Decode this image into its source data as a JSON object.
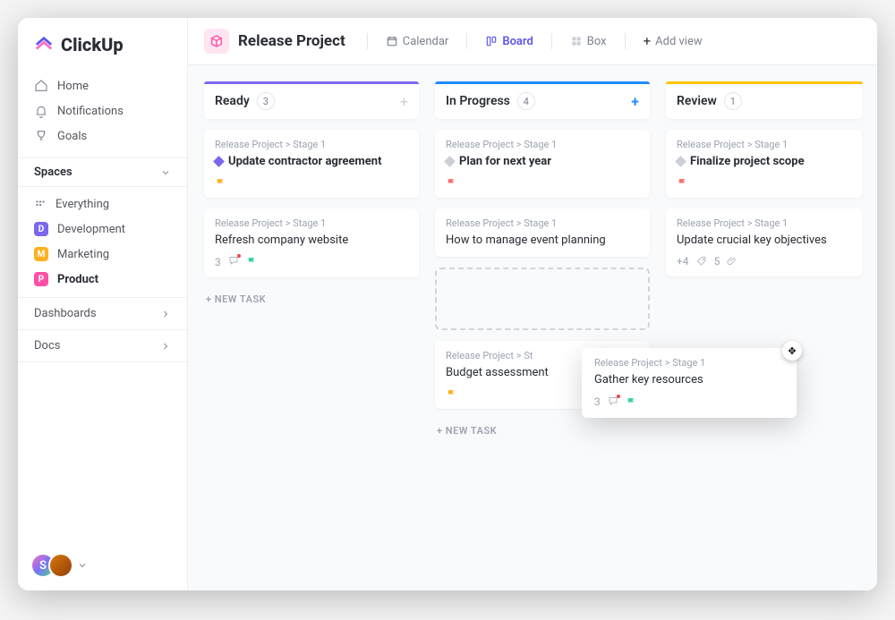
{
  "brand": "ClickUp",
  "nav": {
    "home": "Home",
    "notifications": "Notifications",
    "goals": "Goals"
  },
  "spaces": {
    "header": "Spaces",
    "everything": "Everything",
    "items": [
      {
        "label": "Development",
        "letter": "D",
        "color": "#7b68ee"
      },
      {
        "label": "Marketing",
        "letter": "M",
        "color": "#ffb020"
      },
      {
        "label": "Product",
        "letter": "P",
        "color": "#ff4fa7",
        "active": true
      }
    ]
  },
  "sections": {
    "dashboards": "Dashboards",
    "docs": "Docs"
  },
  "user": {
    "initial": "S"
  },
  "header": {
    "project_title": "Release Project",
    "views": {
      "calendar": "Calendar",
      "board": "Board",
      "box": "Box",
      "add": "Add view"
    }
  },
  "board": {
    "new_task_label": "+ NEW TASK",
    "columns": [
      {
        "name": "Ready",
        "count": "3",
        "bar_color": "#7b68ee",
        "add_color": "#cbd0d8",
        "cards": [
          {
            "crumb": "Release Project > Stage 1",
            "title": "Update contractor agreement",
            "bold": true,
            "diamond": "#7b68ee",
            "flag": "#ffb020"
          },
          {
            "crumb": "Release Project > Stage 1",
            "title": "Refresh company website",
            "comments": "3",
            "flag": "#34d399"
          }
        ]
      },
      {
        "name": "In Progress",
        "count": "4",
        "bar_color": "#1f8bff",
        "add_color": "#1f8bff",
        "cards": [
          {
            "crumb": "Release Project > Stage 1",
            "title": "Plan for next year",
            "bold": true,
            "diamond": "#cbd0d8",
            "flag": "#f97066"
          },
          {
            "crumb": "Release Project > Stage 1",
            "title": "How to manage event planning"
          },
          {
            "placeholder": true
          },
          {
            "crumb": "Release Project > St",
            "title": "Budget assessment",
            "flag": "#ffb020"
          }
        ]
      },
      {
        "name": "Review",
        "count": "1",
        "bar_color": "#ffc300",
        "add_color": "#cbd0d8",
        "cards": [
          {
            "crumb": "Release Project > Stage 1",
            "title": "Finalize project scope",
            "bold": true,
            "diamond": "#cbd0d8",
            "flag": "#f97066"
          },
          {
            "crumb": "Release Project > Stage 1",
            "title": "Update crucial key objectives",
            "tags": "+4",
            "attach": "5"
          }
        ]
      }
    ],
    "dragging": {
      "crumb": "Release Project > Stage 1",
      "title": "Gather key resources",
      "comments": "3",
      "flag": "#34d399"
    }
  }
}
